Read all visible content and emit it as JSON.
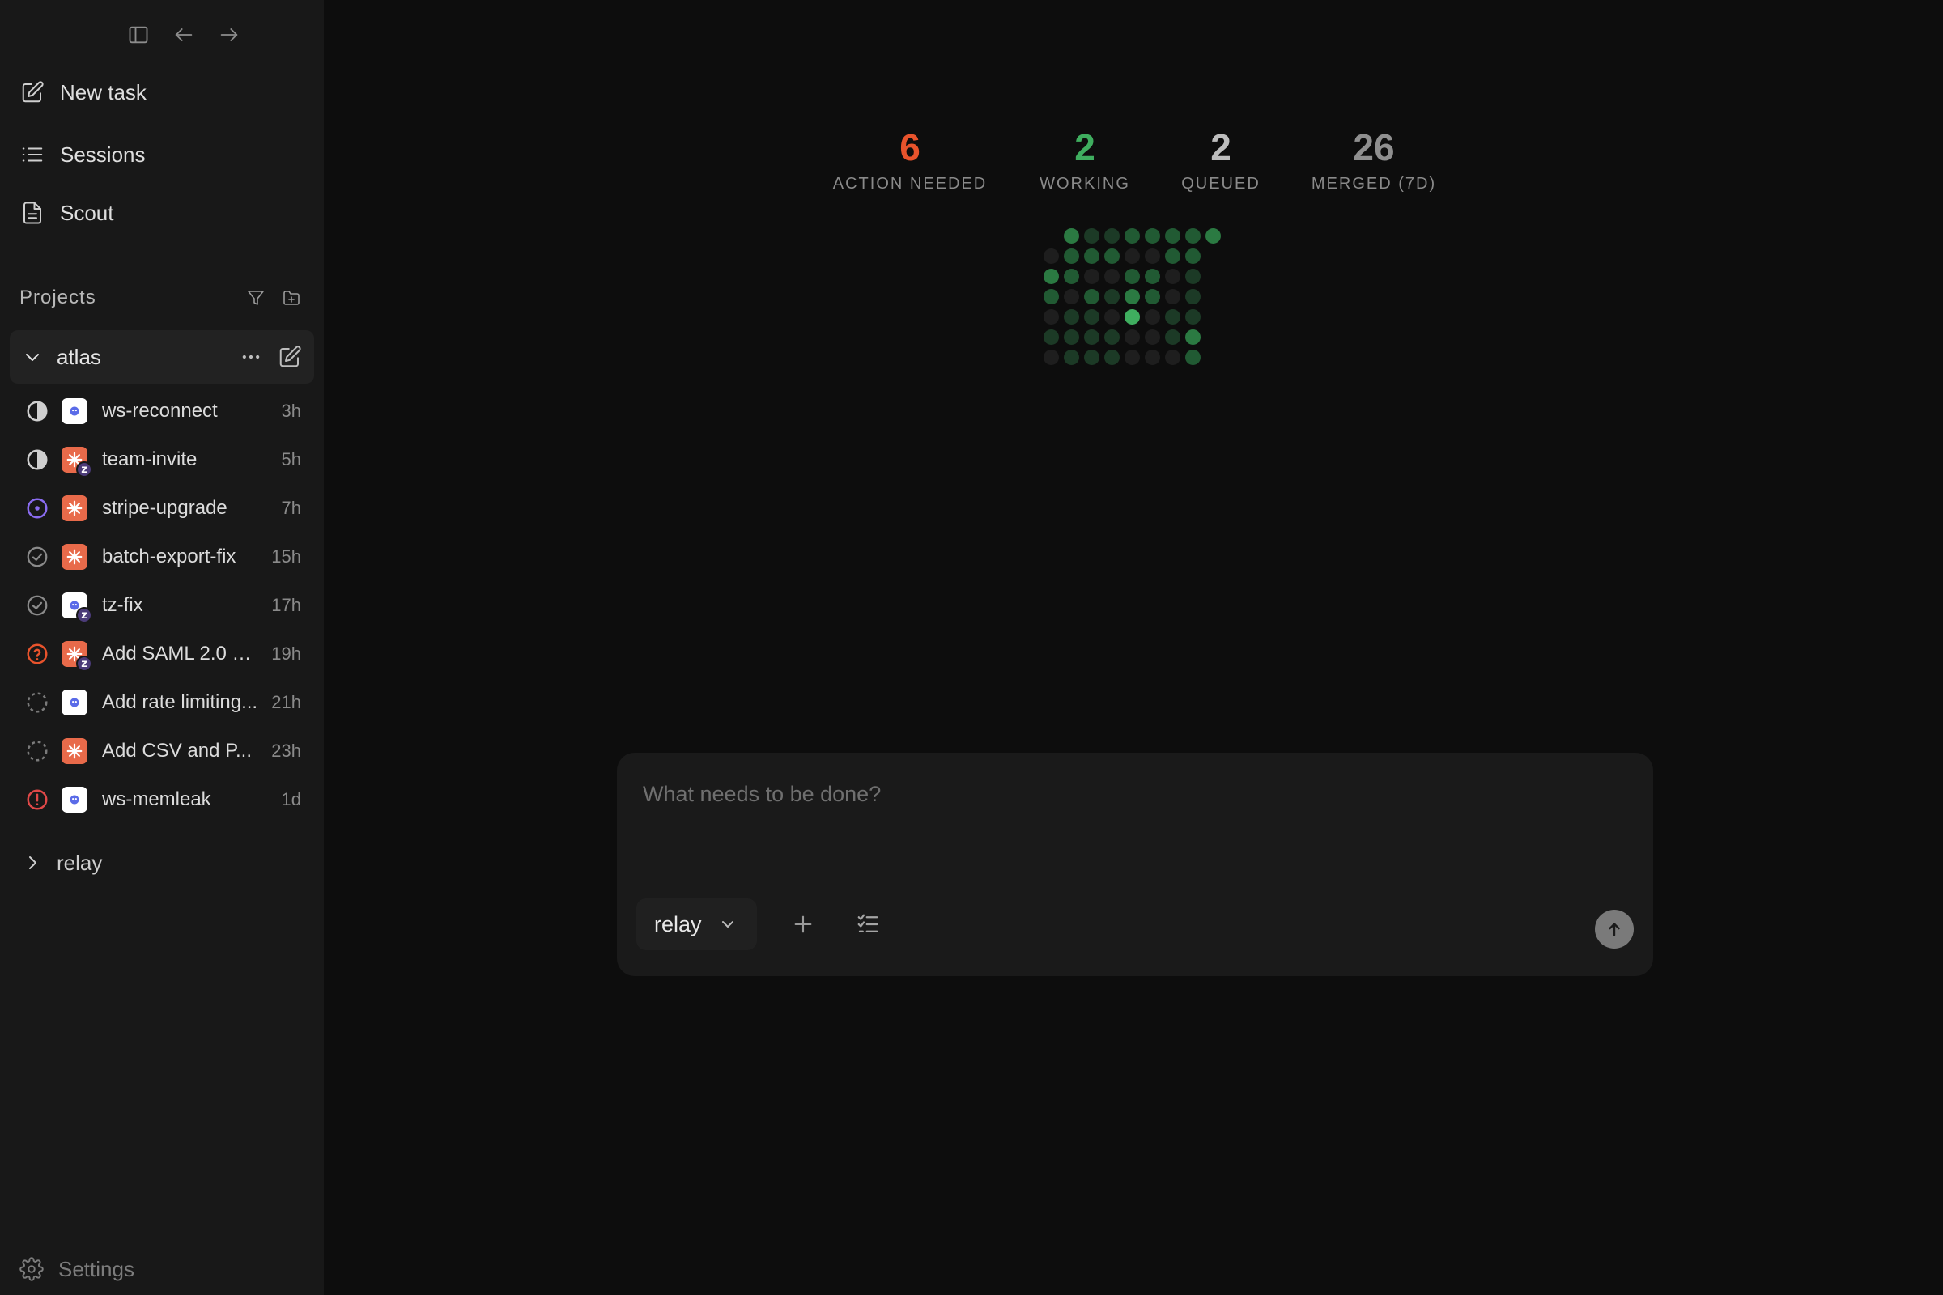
{
  "colors": {
    "action": "#e8532c",
    "working": "#3fae5f",
    "queued": "#bdbdbd",
    "merged": "#8f8f8f",
    "purple": "#8a6cf0",
    "error": "#e04848",
    "agent_orange": "#e86a4a",
    "agent_blue": "#5a6be8"
  },
  "sidebar": {
    "nav": [
      {
        "label": "New task",
        "icon": "edit-square-icon"
      },
      {
        "label": "Sessions",
        "icon": "list-icon"
      },
      {
        "label": "Scout",
        "icon": "document-icon"
      }
    ],
    "projects_title": "Projects",
    "projects": [
      {
        "name": "atlas",
        "expanded": true,
        "tasks": [
          {
            "name": "ws-reconnect",
            "time": "3h",
            "status": "half",
            "agent": "blue",
            "z": false
          },
          {
            "name": "team-invite",
            "time": "5h",
            "status": "half",
            "agent": "orange",
            "z": true
          },
          {
            "name": "stripe-upgrade",
            "time": "7h",
            "status": "running",
            "agent": "orange",
            "z": false
          },
          {
            "name": "batch-export-fix",
            "time": "15h",
            "status": "done",
            "agent": "orange",
            "z": false
          },
          {
            "name": "tz-fix",
            "time": "17h",
            "status": "done",
            "agent": "blue",
            "z": true
          },
          {
            "name": "Add SAML 2.0 si...",
            "time": "19h",
            "status": "question",
            "agent": "orange",
            "z": true
          },
          {
            "name": "Add rate limiting...",
            "time": "21h",
            "status": "pending",
            "agent": "blue",
            "z": false
          },
          {
            "name": "Add CSV and P...",
            "time": "23h",
            "status": "pending",
            "agent": "orange",
            "z": false
          },
          {
            "name": "ws-memleak",
            "time": "1d",
            "status": "error",
            "agent": "blue",
            "z": false
          }
        ]
      },
      {
        "name": "relay",
        "expanded": false
      }
    ],
    "settings_label": "Settings"
  },
  "stats": [
    {
      "value": "6",
      "label": "ACTION NEEDED",
      "color": "#e8532c"
    },
    {
      "value": "2",
      "label": "WORKING",
      "color": "#3fae5f"
    },
    {
      "value": "2",
      "label": "QUEUED",
      "color": "#bdbdbd"
    },
    {
      "value": "26",
      "label": "MERGED (7D)",
      "color": "#8f8f8f"
    }
  ],
  "activity_levels": [
    [
      -1,
      3,
      1,
      1,
      2,
      2,
      2,
      2,
      3
    ],
    [
      0,
      2,
      2,
      2,
      0,
      0,
      2,
      2,
      -1
    ],
    [
      3,
      2,
      0,
      0,
      2,
      2,
      0,
      1,
      -1
    ],
    [
      2,
      0,
      2,
      1,
      3,
      2,
      0,
      1,
      -1
    ],
    [
      0,
      1,
      1,
      0,
      4,
      0,
      1,
      1,
      -1
    ],
    [
      1,
      1,
      1,
      1,
      0,
      0,
      1,
      3,
      -1
    ],
    [
      0,
      1,
      1,
      1,
      0,
      0,
      0,
      2,
      -1
    ]
  ],
  "composer": {
    "placeholder": "What needs to be done?",
    "repo": "relay"
  }
}
